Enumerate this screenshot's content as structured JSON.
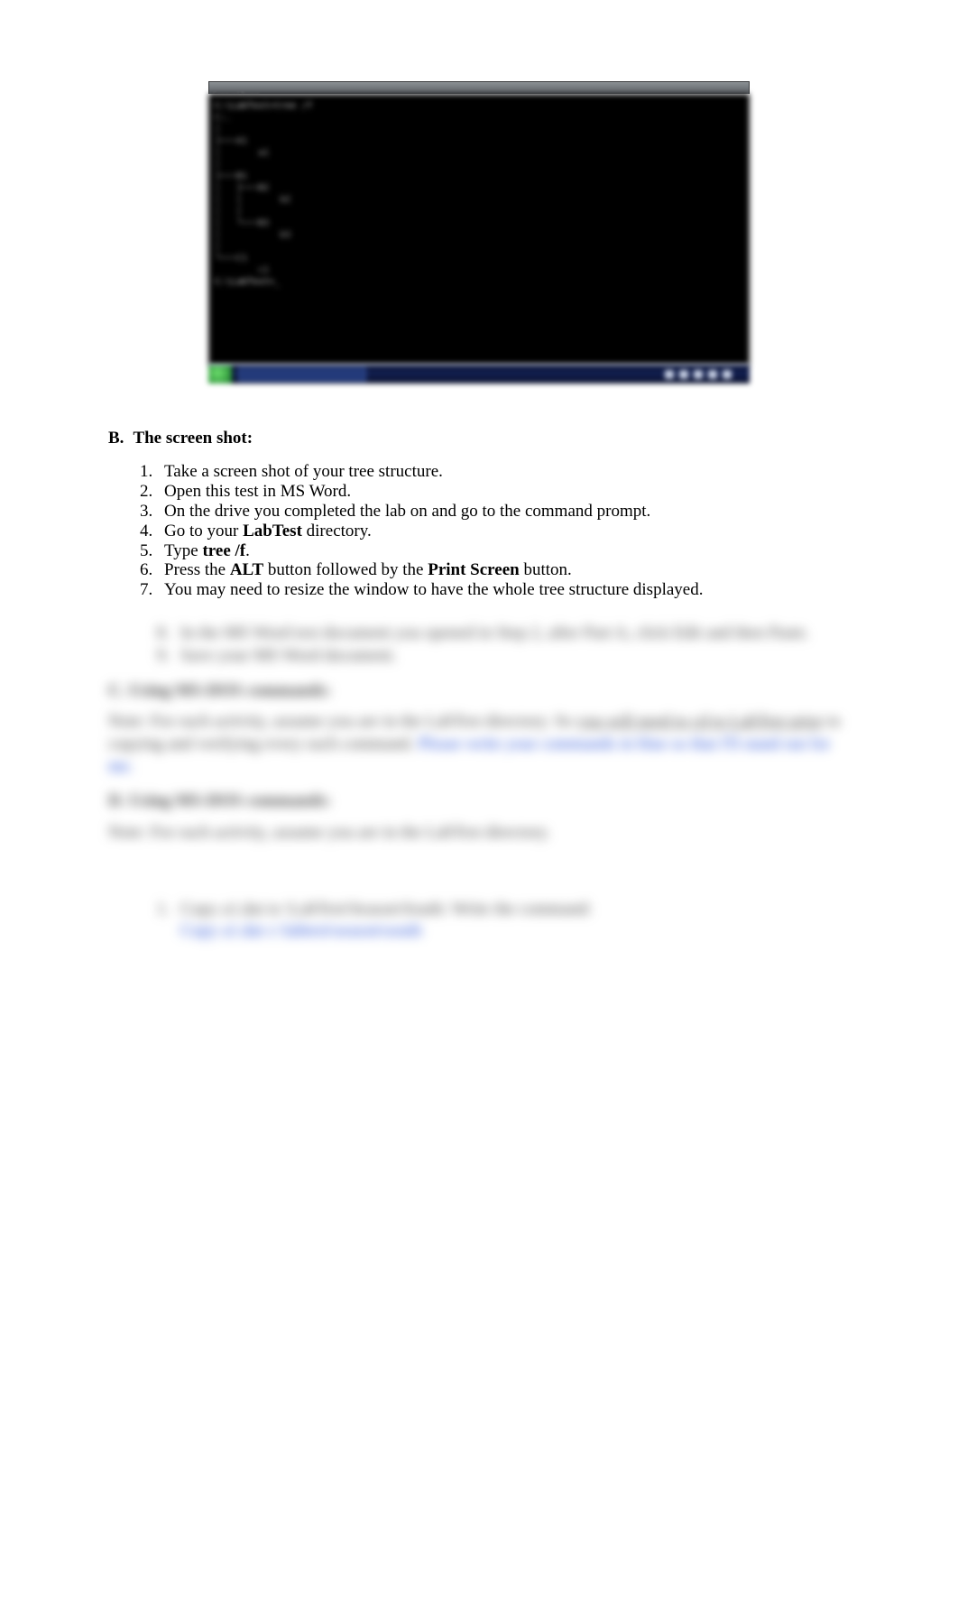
{
  "terminal": {
    "title": "Command Prompt",
    "first_line": "C:\\LabTest>tree /f",
    "lines": [
      "C:.",
      "│",
      "├───A1",
      "│       a1",
      "│",
      "├───B1",
      "│   ├───B2",
      "│   │       b2",
      "│   │",
      "│   └───B3",
      "│           b3",
      "│",
      "└───C1",
      "        c1",
      "",
      "C:\\LabTest>_"
    ]
  },
  "section_b": {
    "letter": "B.",
    "title": "The screen shot:"
  },
  "steps": [
    {
      "text_parts": [
        "Take a screen shot of your tree structure."
      ]
    },
    {
      "text_parts": [
        "Open this test in MS Word."
      ]
    },
    {
      "text_parts": [
        "On the drive you completed the lab on and go to the command prompt."
      ]
    },
    {
      "text_parts": [
        "Go to your ",
        {
          "bold": "LabTest"
        },
        " directory."
      ]
    },
    {
      "text_parts": [
        "Type ",
        {
          "bold": "tree /f"
        },
        "."
      ]
    },
    {
      "text_parts": [
        "Press the ",
        {
          "bold": "ALT"
        },
        " button followed by the ",
        {
          "bold": "Print Screen"
        },
        " button."
      ]
    },
    {
      "text_parts": [
        "You may need to resize the window to have the whole tree structure displayed."
      ]
    }
  ],
  "blurred_steps": {
    "step8": "In the MS Word test document you opened in Step 2, after Part A, click Edit and then Paste.",
    "step9": "Save your MS Word document."
  },
  "blurred_c": {
    "heading": "C. Using MS-DOS commands:",
    "note_prefix": "Note: For each activity, assume you are in the LabTest directory.      So ",
    "note_under": "you will need to cd to LabTest prior",
    "note_mid": " to copying and verifying every each command.     ",
    "note_blue": "Please write your commands in blue so that I'll stand out for me."
  },
  "blurred_d": {
    "heading": "D. Using MS-DOS commands:",
    "note": "Note: For each activity, assume you are in the LabTest directory."
  },
  "blurred_item1": {
    "prefix": "1.",
    "line1": "Copy a1.dat to \\LabTest\\Season\\South:   Write the command:",
    "line2": "Copy a1.dat c:\\labtest\\season\\south"
  }
}
